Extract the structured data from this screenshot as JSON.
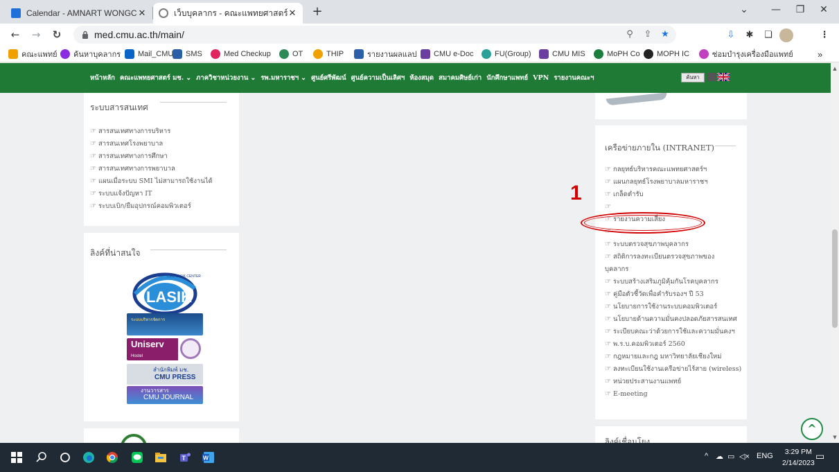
{
  "browser": {
    "tabs": [
      {
        "title": "Calendar - AMNART WONGCHAI",
        "close": "✕",
        "favicon_color": "#1e6fd9"
      },
      {
        "title": "เว็บบุคลากร - คณะแพทยศาสตร์ มหาวิ",
        "close": "✕",
        "favicon_color": "#7a7a7a"
      }
    ],
    "new_tab": "+",
    "window_controls": {
      "menu": "⌄",
      "minimize": "—",
      "restore": "❐",
      "close": "✕"
    },
    "url": "med.cmu.ac.th/main/",
    "bookmarks": [
      {
        "label": "คณะแพทย์",
        "color": "#f0a000"
      },
      {
        "label": "ค้นหาบุคลากร",
        "color": "#8a2be2"
      },
      {
        "label": "Mail_CMU",
        "color": "#0a64c8"
      },
      {
        "label": "SMS",
        "color": "#2b5fa8"
      },
      {
        "label": "Med Checkup",
        "color": "#e0245e"
      },
      {
        "label": "OT",
        "color": "#2e8b57"
      },
      {
        "label": "THIP",
        "color": "#f0a000"
      },
      {
        "label": "รายงานผลแลป",
        "color": "#2b5fa8"
      },
      {
        "label": "CMU e-Doc",
        "color": "#6a3fa0"
      },
      {
        "label": "FU(Group)",
        "color": "#2aa198"
      },
      {
        "label": "CMU MIS",
        "color": "#6a3fa0"
      },
      {
        "label": "MoPH Co",
        "color": "#1a7f3c"
      },
      {
        "label": "MOPH IC",
        "color": "#222222"
      },
      {
        "label": "ซ่อมบำรุงเครื่องมือแพทย์",
        "color": "#c040c0"
      }
    ],
    "bookmarks_more": "»"
  },
  "site_nav": {
    "items": [
      "หน้าหลัก",
      "คณะแพทยศาสตร์ มช.",
      "⌄",
      "ภาควิชาหน่วยงาน",
      "⌄",
      "รพ.มหาราชฯ",
      "⌄",
      "ศูนย์ศรีพัฒน์",
      "ศูนย์ความเป็นเลิศฯ",
      "ห้องสมุด",
      "สมาคมศิษย์เก่า",
      "นักศึกษาแพทย์",
      "VPN",
      "รายงานคณะฯ"
    ],
    "search_label": "ค้นหา"
  },
  "left_sidebar": {
    "info_title": "ระบบสารสนเทศ",
    "info_links": [
      "สารสนเทศทางการบริหาร",
      "สารสนเทศโรงพยาบาล",
      "สารสนเทศทางการศึกษา",
      "สารสนเทศทางการพยาบาล",
      "แผนเมื่อระบบ SMI ไม่สามารถใช้งานได้",
      "ระบบแจ้งปัญหา IT",
      "ระบบเบิก/ยืมอุปกรณ์คอมพิวเตอร์"
    ],
    "links_title": "ลิงค์ที่น่าสนใจ",
    "banners": [
      {
        "text": "LASIK",
        "sub": "CMU LASIK CENTER"
      },
      {
        "text": "ระบบบริหารจัดการ"
      },
      {
        "text": "Uniserv",
        "sub": "Hostel"
      },
      {
        "text": "สำนักพิมพ์ มช.",
        "sub": "CMU PRESS"
      },
      {
        "text": "งานวารสาร",
        "sub": "CMU JOURNAL"
      }
    ]
  },
  "right_sidebar": {
    "intranet_title": "เครือข่ายภายใน (INTRANET)",
    "intranet_links": [
      "กลยุทธ์บริหารคณะแพทยศาสตร์ฯ",
      "แผนกลยุทธ์โรงพยาบาลมหาราชฯ",
      "เกล็ดตำรับ",
      "",
      "รายงานความเสี่ยง",
      "",
      "ระบบตรวจสุขภาพบุคลากร",
      "สถิติการลงทะเบียนตรวจสุขภาพของ",
      "บุคลากร",
      "ระบบสร้างเสริมภูมิคุ้มกันโรคบุคลากร",
      "คู่มือตัวชี้วัดเพื่อคำรับรองฯ ปี 53",
      "นโยบายการใช้งานระบบคอมพิวเตอร์",
      "นโยบายด้านความมั่นคงปลอดภัยสารสนเทศ",
      "ระเบียบคณะว่าด้วยการใช้และความมั่นคงฯ",
      "พ.ร.บ.คอมพิวเตอร์ 2560",
      "กฎหมายและกฎ มหาวิทยาลัยเชียงใหม่",
      "ลงทะเบียนใช้งานเครือข่ายไร้สาย (wireless)",
      "หน่วยประสานงานแพทย์",
      "E-meeting"
    ],
    "bottom_title": "ลิงค์เชื่อมโยง"
  },
  "annotation": {
    "number": "1"
  },
  "taskbar": {
    "language": "ENG",
    "time": "3:29 PM",
    "date": "2/14/2023"
  }
}
